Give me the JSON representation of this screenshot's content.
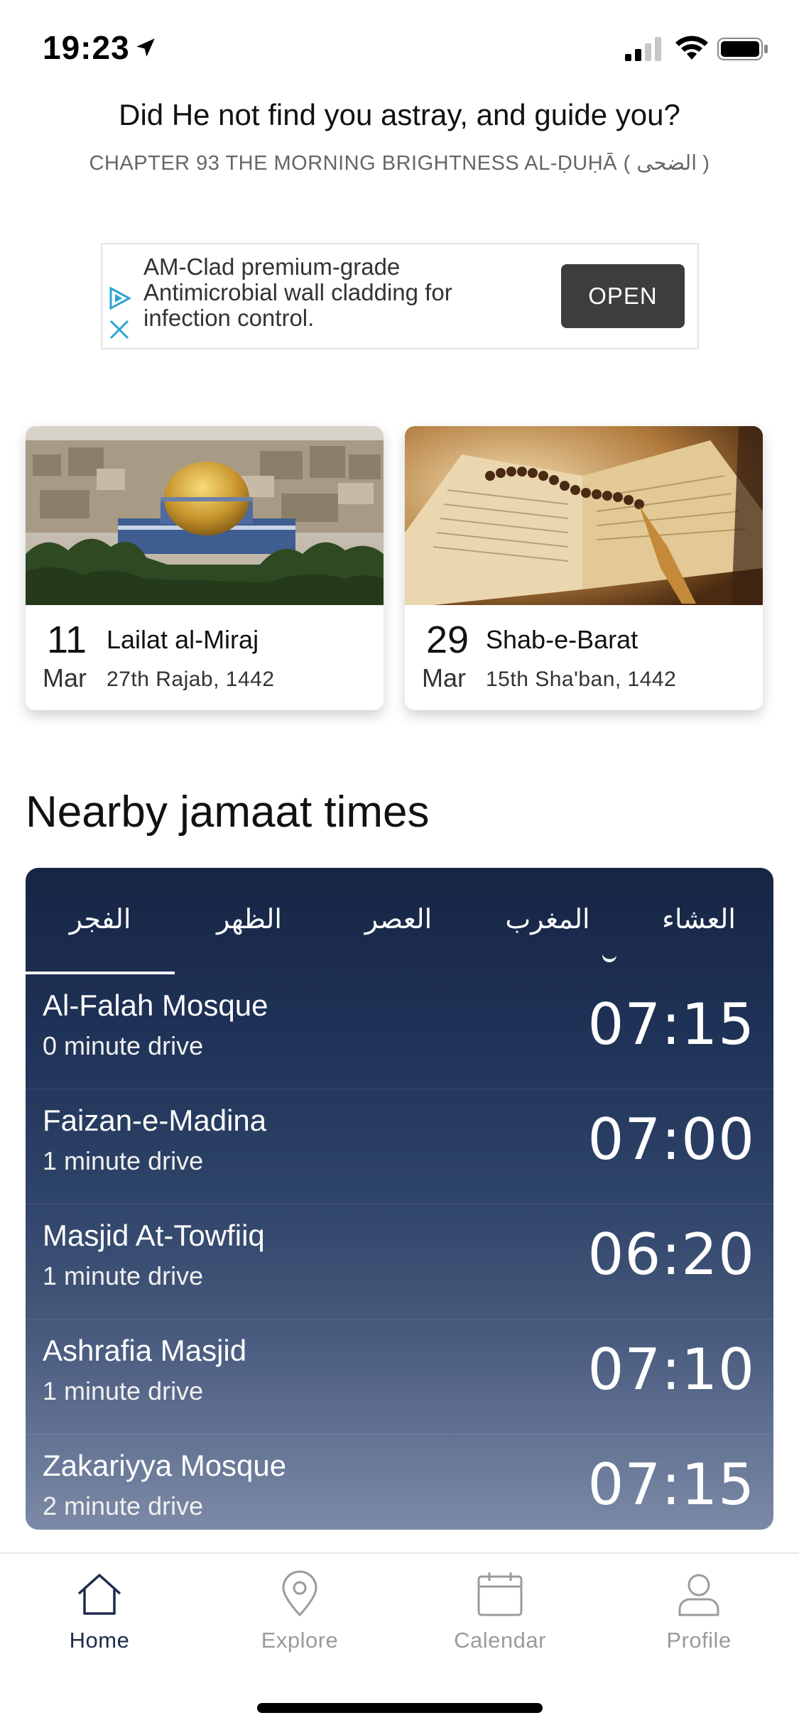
{
  "status": {
    "time": "19:23"
  },
  "verse": {
    "text": "Did He not find you astray, and guide you?",
    "reference": "CHAPTER 93 THE MORNING BRIGHTNESS AL-ḌUḤĀ ( الضحى )"
  },
  "ad": {
    "text": "AM-Clad premium-grade Antimicrobial wall cladding for infection control.",
    "button_label": "OPEN"
  },
  "events": [
    {
      "day": "11",
      "month": "Mar",
      "title": "Lailat al-Miraj",
      "hijri": "27th Rajab, 1442"
    },
    {
      "day": "29",
      "month": "Mar",
      "title": "Shab-e-Barat",
      "hijri": "15th Sha'ban, 1442"
    }
  ],
  "section_title": "Nearby jamaat times",
  "prayer_tabs": [
    "الفجر",
    "الظهر",
    "العصر",
    "المغرب",
    "العشاء"
  ],
  "active_tab_index": 0,
  "mosques": [
    {
      "name": "Al-Falah Mosque",
      "drive": "0 minute drive",
      "time": "07:15"
    },
    {
      "name": "Faizan-e-Madina",
      "drive": "1 minute drive",
      "time": "07:00"
    },
    {
      "name": "Masjid At-Towfiiq",
      "drive": "1 minute drive",
      "time": "06:20"
    },
    {
      "name": "Ashrafia Masjid",
      "drive": "1 minute drive",
      "time": "07:10"
    },
    {
      "name": "Zakariyya Mosque",
      "drive": "2 minute drive",
      "time": "07:15"
    }
  ],
  "tabbar": [
    {
      "label": "Home",
      "icon": "home-icon",
      "active": true
    },
    {
      "label": "Explore",
      "icon": "location-pin-icon",
      "active": false
    },
    {
      "label": "Calendar",
      "icon": "calendar-icon",
      "active": false
    },
    {
      "label": "Profile",
      "icon": "person-icon",
      "active": false
    }
  ],
  "colors": {
    "active_tab": "#1e2b4d",
    "inactive_tab": "#9b9b9b",
    "ad_button": "#3d3d3d",
    "panel_top": "#172544"
  }
}
